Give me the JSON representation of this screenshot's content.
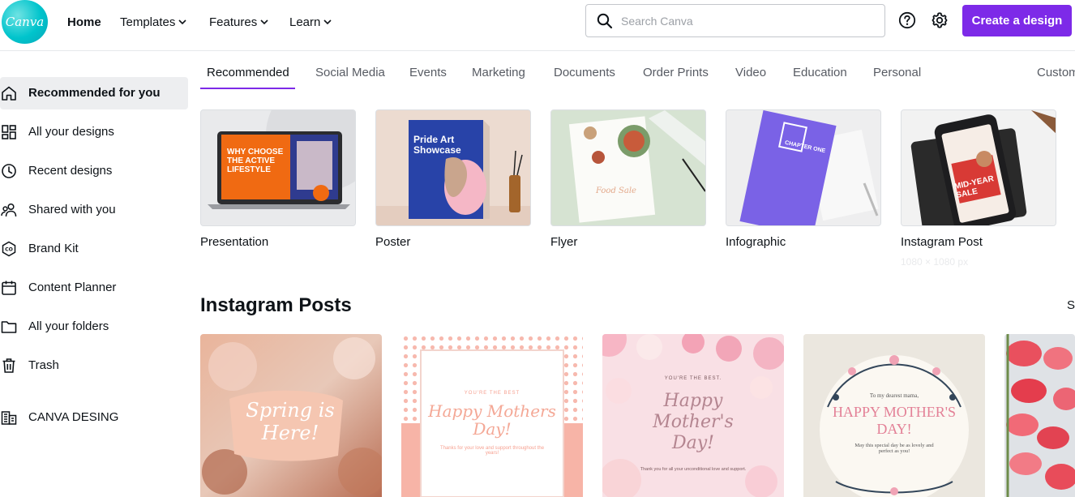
{
  "brand": {
    "logo_text": "Canva",
    "accent": "#7d2ae8",
    "logo_color": "#00c4cc"
  },
  "header": {
    "nav": [
      {
        "label": "Home"
      },
      {
        "label": "Templates"
      },
      {
        "label": "Features"
      },
      {
        "label": "Learn"
      }
    ],
    "search": {
      "placeholder": "Search Canva",
      "value": ""
    },
    "help_icon": "question-circle-icon",
    "settings_icon": "gear-icon",
    "create_label": "Create a design"
  },
  "sidebar": {
    "items": [
      {
        "label": "Recommended for you",
        "icon": "home-icon"
      },
      {
        "label": "All your designs",
        "icon": "grid-icon"
      },
      {
        "label": "Recent designs",
        "icon": "clock-icon"
      },
      {
        "label": "Shared with you",
        "icon": "people-icon"
      },
      {
        "label": "Brand Kit",
        "icon": "brand-kit-icon"
      },
      {
        "label": "Content Planner",
        "icon": "calendar-icon"
      },
      {
        "label": "All your folders",
        "icon": "folder-icon"
      },
      {
        "label": "Trash",
        "icon": "trash-icon"
      },
      {
        "label": "CANVA DESING",
        "icon": "team-building-icon"
      }
    ]
  },
  "tabs": [
    {
      "label": "Recommended"
    },
    {
      "label": "Social Media"
    },
    {
      "label": "Events"
    },
    {
      "label": "Marketing"
    },
    {
      "label": "Documents"
    },
    {
      "label": "Order Prints"
    },
    {
      "label": "Video"
    },
    {
      "label": "Education"
    },
    {
      "label": "Personal"
    },
    {
      "label": "Custom"
    }
  ],
  "recommended": [
    {
      "label": "Presentation",
      "thumb_text": "WHY CHOOSE THE ACTIVE LIFESTYLE"
    },
    {
      "label": "Poster",
      "thumb_text": "Pride Art Showcase"
    },
    {
      "label": "Flyer",
      "thumb_text": "Food Sale"
    },
    {
      "label": "Infographic",
      "thumb_text": "CHAPTER ONE"
    },
    {
      "label": "Instagram Post",
      "sub": "1080 × 1080 px",
      "thumb_text": "MID-YEAR SALE"
    }
  ],
  "section": {
    "title": "Instagram Posts",
    "see_all": "See all",
    "cards": [
      {
        "kicker": "",
        "title": "Spring is Here!",
        "body": ""
      },
      {
        "kicker": "YOU'RE THE BEST",
        "title": "Happy Mothers Day!",
        "body": "Thanks for your love and support throughout the years!"
      },
      {
        "kicker": "YOU'RE THE BEST.",
        "title": "Happy Mother's Day!",
        "body": "Thank you for all your unconditional love and support."
      },
      {
        "kicker": "To my dearest mama,",
        "title": "HAPPY MOTHER'S DAY!",
        "body": "May this special day be as lovely and perfect as you!"
      },
      {
        "kicker": "",
        "title": "",
        "body": ""
      }
    ]
  }
}
